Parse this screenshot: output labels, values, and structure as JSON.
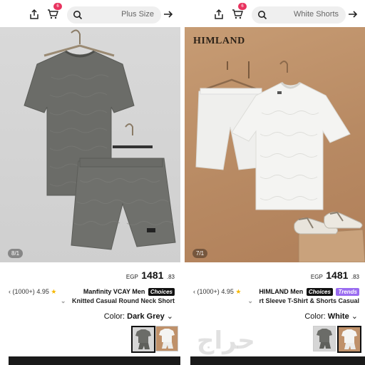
{
  "panels": [
    {
      "cart_badge": "6",
      "search_placeholder": "Plus Size",
      "image_counter": "8/1",
      "price": {
        "currency": "EGP",
        "integer": "1481",
        "decimal": ".83"
      },
      "rating": {
        "prefix": "‹",
        "count": "(1000+)",
        "score": "4.95",
        "star": "★"
      },
      "title_line1": {
        "brand": "Manfinity VCAY Men",
        "tags": [
          "Choices"
        ]
      },
      "title_line2": "Knitted Casual Round Neck Short",
      "color": {
        "label": "Color:",
        "value": "Dark Grey"
      },
      "colors": {
        "garment": "#6b6c68",
        "background": "#d6d6d6"
      }
    },
    {
      "cart_badge": "6",
      "search_placeholder": "White Shorts",
      "image_counter": "7/1",
      "brand_logo": "HIMLAND",
      "price": {
        "currency": "EGP",
        "integer": "1481",
        "decimal": ".83"
      },
      "rating": {
        "prefix": "‹",
        "count": "(1000+)",
        "score": "4.95",
        "star": "★"
      },
      "title_line1": {
        "brand": "HIMLAND Men",
        "tags": [
          "Choices",
          "Trends"
        ]
      },
      "title_line2": "rt Sleeve T-Shirt & Shorts Casual",
      "color": {
        "label": "Color:",
        "value": "White"
      },
      "colors": {
        "garment": "#f4f4f2",
        "background": "#bf916a"
      }
    }
  ],
  "watermark": "حراج"
}
